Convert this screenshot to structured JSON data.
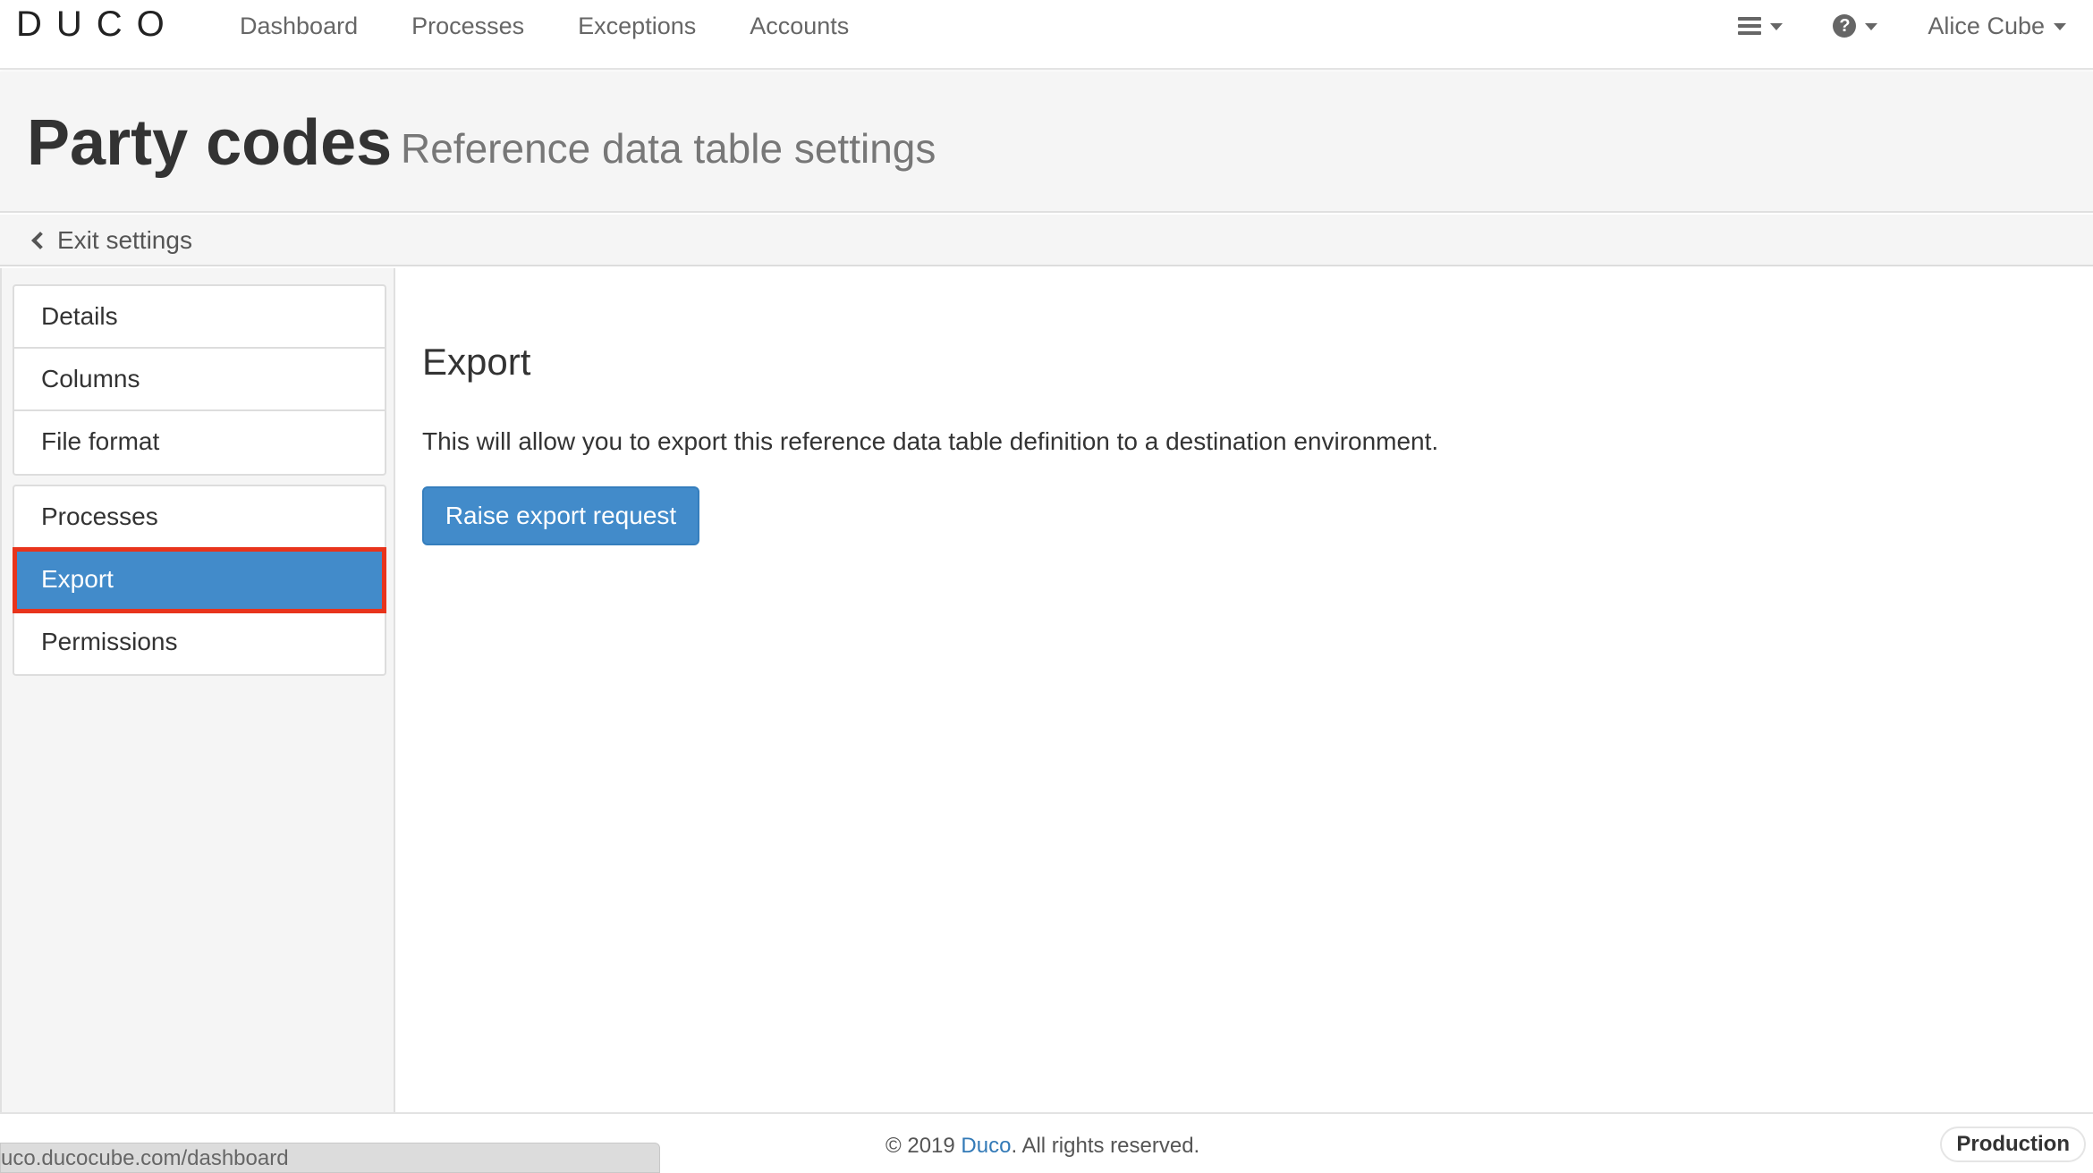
{
  "navbar": {
    "logo": "DUCO",
    "links": [
      "Dashboard",
      "Processes",
      "Exceptions",
      "Accounts"
    ],
    "user": "Alice Cube",
    "icons": {
      "menu": "hamburger-icon",
      "help": "question-circle-icon"
    }
  },
  "header": {
    "title": "Party codes",
    "subtitle": "Reference data table settings"
  },
  "exit": {
    "label": "Exit settings"
  },
  "sidebar": {
    "group1": [
      "Details",
      "Columns",
      "File format"
    ],
    "group2": [
      "Processes",
      "Export",
      "Permissions"
    ],
    "active": "Export"
  },
  "main": {
    "section_title": "Export",
    "description": "This will allow you to export this reference data table definition to a destination environment.",
    "button_label": "Raise export request"
  },
  "footer": {
    "copyright_prefix": "© 2019 ",
    "brand": "Duco",
    "copyright_suffix": ". All rights reserved.",
    "environment": "Production"
  },
  "status_bar": {
    "url": "uco.ducocube.com/dashboard"
  },
  "colors": {
    "primary": "#428bca",
    "highlight": "#e8341c",
    "link": "#337ab7"
  }
}
